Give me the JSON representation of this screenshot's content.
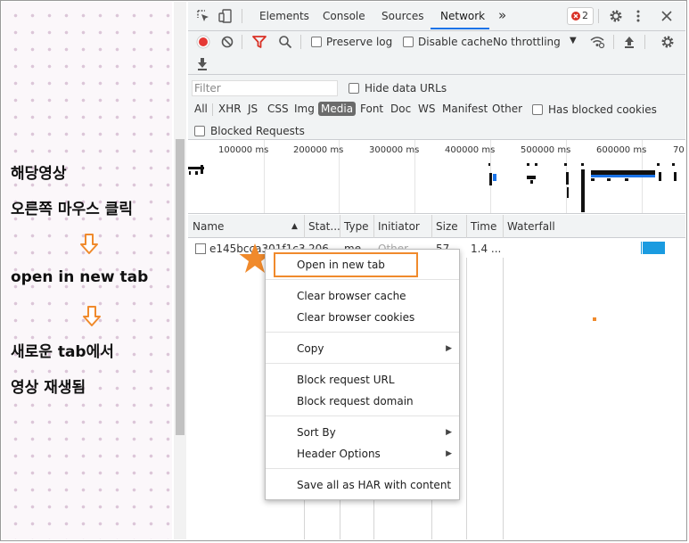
{
  "annotations": {
    "line1": "해당영상",
    "line2": "오른쪽 마우스 클릭",
    "line3": "open in new tab",
    "line4": "새로운 tab에서",
    "line5": "영상 재생됨"
  },
  "devtools": {
    "tabs": [
      "Elements",
      "Console",
      "Sources",
      "Network"
    ],
    "active_tab": "Network",
    "more_tabs": "»",
    "error_count": "2",
    "toolbar": {
      "preserve_log": "Preserve log",
      "disable_cache": "Disable cache",
      "throttling": "No throttling"
    },
    "filter": {
      "placeholder": "Filter",
      "hide_data_urls": "Hide data URLs",
      "types": [
        "All",
        "XHR",
        "JS",
        "CSS",
        "Img",
        "Media",
        "Font",
        "Doc",
        "WS",
        "Manifest",
        "Other"
      ],
      "selected_type": "Media",
      "has_blocked_cookies": "Has blocked cookies",
      "blocked_requests": "Blocked Requests"
    },
    "overview": {
      "ticks": [
        "100000 ms",
        "200000 ms",
        "300000 ms",
        "400000 ms",
        "500000 ms",
        "600000 ms",
        "70"
      ]
    },
    "columns": [
      "Name",
      "Stat...",
      "Type",
      "Initiator",
      "Size",
      "Time",
      "Waterfall"
    ],
    "rows": [
      {
        "name": "e145bcca301f1c3",
        "status": "206",
        "type": "me",
        "initiator": "Other",
        "size": "57",
        "time": "1.4 ..."
      }
    ],
    "context_menu": {
      "items": [
        {
          "label": "Open in new tab",
          "highlighted": true
        },
        {
          "label": "Clear browser cache"
        },
        {
          "label": "Clear browser cookies"
        },
        {
          "label": "Copy",
          "submenu": true
        },
        {
          "label": "Block request URL"
        },
        {
          "label": "Block request domain"
        },
        {
          "label": "Sort By",
          "submenu": true
        },
        {
          "label": "Header Options",
          "submenu": true
        },
        {
          "label": "Save all as HAR with content"
        }
      ]
    }
  },
  "colors": {
    "accent_orange": "#f08a2c",
    "record_red": "#e53935",
    "network_tab_underline": "#1a73e8",
    "waterfall_bar": "#1a9be0"
  }
}
